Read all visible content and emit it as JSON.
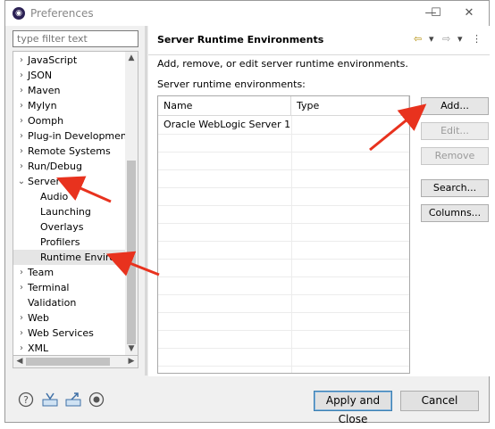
{
  "window": {
    "title": "Preferences",
    "app_icon": "eclipse-icon"
  },
  "window_controls": {
    "minimize": "—",
    "maximize": "☐",
    "close": "✕"
  },
  "filter": {
    "placeholder": "type filter text"
  },
  "tree": {
    "items": [
      {
        "label": "JavaScript",
        "chevron": "›"
      },
      {
        "label": "JSON",
        "chevron": "›"
      },
      {
        "label": "Maven",
        "chevron": "›"
      },
      {
        "label": "Mylyn",
        "chevron": "›"
      },
      {
        "label": "Oomph",
        "chevron": "›"
      },
      {
        "label": "Plug-in Development",
        "chevron": "›"
      },
      {
        "label": "Remote Systems",
        "chevron": "›"
      },
      {
        "label": "Run/Debug",
        "chevron": "›"
      },
      {
        "label": "Server",
        "chevron": "⌄"
      },
      {
        "label": "Audio",
        "chevron": ""
      },
      {
        "label": "Launching",
        "chevron": ""
      },
      {
        "label": "Overlays",
        "chevron": ""
      },
      {
        "label": "Profilers",
        "chevron": ""
      },
      {
        "label": "Runtime Environme",
        "chevron": ""
      },
      {
        "label": "Team",
        "chevron": "›"
      },
      {
        "label": "Terminal",
        "chevron": "›"
      },
      {
        "label": "Validation",
        "chevron": ""
      },
      {
        "label": "Web",
        "chevron": "›"
      },
      {
        "label": "Web Services",
        "chevron": "›"
      },
      {
        "label": "XML",
        "chevron": "›"
      }
    ],
    "selected_index": 13
  },
  "scroll_glyphs": {
    "up": "▲",
    "down": "▼",
    "left": "◀",
    "right": "▶"
  },
  "page": {
    "title": "Server Runtime Environments",
    "description": "Add, remove, or edit server runtime environments.",
    "list_label": "Server runtime environments:",
    "nav": {
      "back": "⇦",
      "back_menu": "▾",
      "forward": "⇨",
      "forward_menu": "▾",
      "view_menu": "⋮"
    }
  },
  "table": {
    "columns": [
      "Name",
      "Type"
    ],
    "rows": [
      {
        "name": "Oracle WebLogic Server 1...",
        "type": ""
      }
    ]
  },
  "buttons": {
    "add": "Add...",
    "edit": "Edit...",
    "remove": "Remove",
    "search": "Search...",
    "columns": "Columns..."
  },
  "footer": {
    "icons": [
      "help-icon",
      "import-icon",
      "export-icon",
      "record-icon"
    ],
    "apply_close": "Apply and Close",
    "cancel": "Cancel"
  },
  "colors": {
    "annotation_arrow": "#e8321e",
    "accent": "#3c7fb1"
  }
}
